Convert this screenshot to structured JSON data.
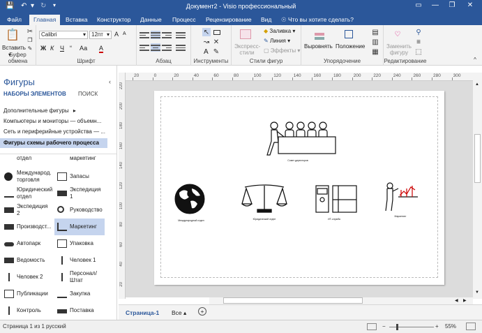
{
  "window": {
    "title": "Документ2 - Visio профессиональный",
    "minimize": "—",
    "restore": "❐",
    "close": "✕",
    "ribbon_display": "▭"
  },
  "tabs": [
    {
      "label": "Файл"
    },
    {
      "label": "Главная"
    },
    {
      "label": "Вставка"
    },
    {
      "label": "Конструктор"
    },
    {
      "label": "Данные"
    },
    {
      "label": "Процесс"
    },
    {
      "label": "Рецензирование"
    },
    {
      "label": "Вид"
    }
  ],
  "tell_me": "Что вы хотите сделать?",
  "ribbon": {
    "clipboard": {
      "paste": "Вставить",
      "label": "Буфер обмена"
    },
    "font": {
      "name": "Calibri",
      "size": "12пт",
      "label": "Шрифт",
      "bold": "Ж",
      "italic": "К",
      "underline": "Ч",
      "case": "Аа",
      "grow": "A",
      "shrink": "A",
      "color": "A"
    },
    "paragraph": {
      "label": "Абзац"
    },
    "tools": {
      "label": "Инструменты",
      "text": "A"
    },
    "styles": {
      "express": "Экспресс-стили",
      "fill": "Заливка",
      "line": "Линия",
      "effects": "Эффекты",
      "label": "Стили фигур"
    },
    "arrange": {
      "align": "Выровнять",
      "position": "Положение",
      "label": "Упорядочение"
    },
    "editing": {
      "replace": "Заменить фигуру",
      "label": "Редактирование"
    }
  },
  "pane": {
    "title": "Фигуры",
    "tab_stencils": "НАБОРЫ ЭЛЕМЕНТОВ",
    "tab_search": "ПОИСК",
    "stencils": [
      "Дополнительные фигуры",
      "Компьютеры и мониторы — объемн...",
      "Сеть и периферийные устройства — ...",
      "Фигуры схемы рабочего процесса"
    ],
    "shapes": [
      "отдел",
      "маркетинг",
      "Международ. торговля",
      "Запасы",
      "Юридический отдел",
      "Экспедиция 1",
      "Экспедиция 2",
      "Руководство",
      "Производст...",
      "Маркетинг",
      "Автопарк",
      "Упаковка",
      "Ведомость",
      "Человек 1",
      "Человек 2",
      "Персонал/ Штат",
      "Публикации",
      "Закупка",
      "Контроль",
      "Поставка"
    ]
  },
  "ruler": {
    "h": [
      "20",
      "0",
      "20",
      "40",
      "60",
      "80",
      "100",
      "120",
      "140",
      "160",
      "180",
      "200",
      "220",
      "240",
      "260",
      "280",
      "300"
    ],
    "v": [
      "220",
      "200",
      "180",
      "160",
      "140",
      "120",
      "100",
      "80",
      "60",
      "40",
      "20"
    ]
  },
  "drawing": {
    "captions": [
      "Совет директоров",
      "Международный отдел",
      "Юридический отдел",
      "ИТ-служба",
      "Маркетинг"
    ]
  },
  "pages": {
    "current": "Страница-1",
    "all": "Все",
    "add": "+"
  },
  "status": {
    "page": "Страница 1 из 1",
    "lang": "русский",
    "zoom": "55%"
  }
}
